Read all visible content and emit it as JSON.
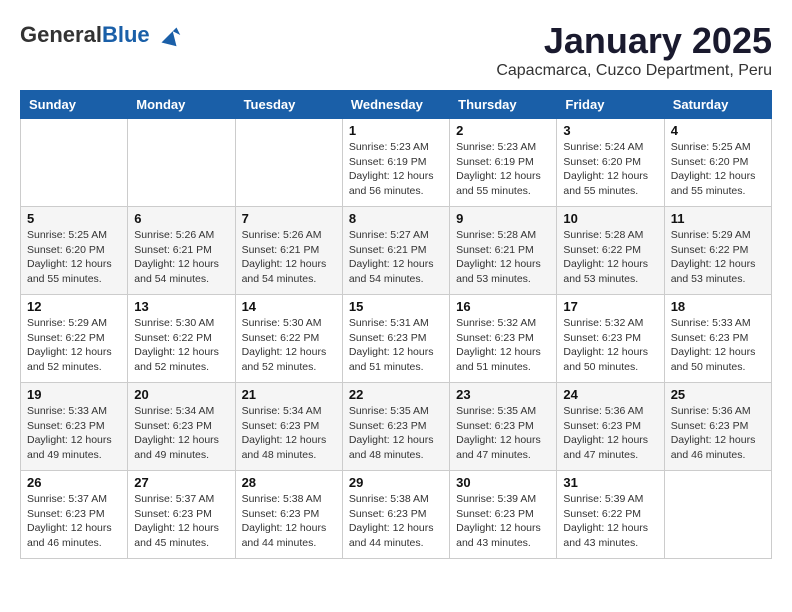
{
  "logo": {
    "general": "General",
    "blue": "Blue"
  },
  "header": {
    "month": "January 2025",
    "location": "Capacmarca, Cuzco Department, Peru"
  },
  "weekdays": [
    "Sunday",
    "Monday",
    "Tuesday",
    "Wednesday",
    "Thursday",
    "Friday",
    "Saturday"
  ],
  "weeks": [
    [
      {
        "day": "",
        "sunrise": "",
        "sunset": "",
        "daylight": ""
      },
      {
        "day": "",
        "sunrise": "",
        "sunset": "",
        "daylight": ""
      },
      {
        "day": "",
        "sunrise": "",
        "sunset": "",
        "daylight": ""
      },
      {
        "day": "1",
        "sunrise": "Sunrise: 5:23 AM",
        "sunset": "Sunset: 6:19 PM",
        "daylight": "Daylight: 12 hours and 56 minutes."
      },
      {
        "day": "2",
        "sunrise": "Sunrise: 5:23 AM",
        "sunset": "Sunset: 6:19 PM",
        "daylight": "Daylight: 12 hours and 55 minutes."
      },
      {
        "day": "3",
        "sunrise": "Sunrise: 5:24 AM",
        "sunset": "Sunset: 6:20 PM",
        "daylight": "Daylight: 12 hours and 55 minutes."
      },
      {
        "day": "4",
        "sunrise": "Sunrise: 5:25 AM",
        "sunset": "Sunset: 6:20 PM",
        "daylight": "Daylight: 12 hours and 55 minutes."
      }
    ],
    [
      {
        "day": "5",
        "sunrise": "Sunrise: 5:25 AM",
        "sunset": "Sunset: 6:20 PM",
        "daylight": "Daylight: 12 hours and 55 minutes."
      },
      {
        "day": "6",
        "sunrise": "Sunrise: 5:26 AM",
        "sunset": "Sunset: 6:21 PM",
        "daylight": "Daylight: 12 hours and 54 minutes."
      },
      {
        "day": "7",
        "sunrise": "Sunrise: 5:26 AM",
        "sunset": "Sunset: 6:21 PM",
        "daylight": "Daylight: 12 hours and 54 minutes."
      },
      {
        "day": "8",
        "sunrise": "Sunrise: 5:27 AM",
        "sunset": "Sunset: 6:21 PM",
        "daylight": "Daylight: 12 hours and 54 minutes."
      },
      {
        "day": "9",
        "sunrise": "Sunrise: 5:28 AM",
        "sunset": "Sunset: 6:21 PM",
        "daylight": "Daylight: 12 hours and 53 minutes."
      },
      {
        "day": "10",
        "sunrise": "Sunrise: 5:28 AM",
        "sunset": "Sunset: 6:22 PM",
        "daylight": "Daylight: 12 hours and 53 minutes."
      },
      {
        "day": "11",
        "sunrise": "Sunrise: 5:29 AM",
        "sunset": "Sunset: 6:22 PM",
        "daylight": "Daylight: 12 hours and 53 minutes."
      }
    ],
    [
      {
        "day": "12",
        "sunrise": "Sunrise: 5:29 AM",
        "sunset": "Sunset: 6:22 PM",
        "daylight": "Daylight: 12 hours and 52 minutes."
      },
      {
        "day": "13",
        "sunrise": "Sunrise: 5:30 AM",
        "sunset": "Sunset: 6:22 PM",
        "daylight": "Daylight: 12 hours and 52 minutes."
      },
      {
        "day": "14",
        "sunrise": "Sunrise: 5:30 AM",
        "sunset": "Sunset: 6:22 PM",
        "daylight": "Daylight: 12 hours and 52 minutes."
      },
      {
        "day": "15",
        "sunrise": "Sunrise: 5:31 AM",
        "sunset": "Sunset: 6:23 PM",
        "daylight": "Daylight: 12 hours and 51 minutes."
      },
      {
        "day": "16",
        "sunrise": "Sunrise: 5:32 AM",
        "sunset": "Sunset: 6:23 PM",
        "daylight": "Daylight: 12 hours and 51 minutes."
      },
      {
        "day": "17",
        "sunrise": "Sunrise: 5:32 AM",
        "sunset": "Sunset: 6:23 PM",
        "daylight": "Daylight: 12 hours and 50 minutes."
      },
      {
        "day": "18",
        "sunrise": "Sunrise: 5:33 AM",
        "sunset": "Sunset: 6:23 PM",
        "daylight": "Daylight: 12 hours and 50 minutes."
      }
    ],
    [
      {
        "day": "19",
        "sunrise": "Sunrise: 5:33 AM",
        "sunset": "Sunset: 6:23 PM",
        "daylight": "Daylight: 12 hours and 49 minutes."
      },
      {
        "day": "20",
        "sunrise": "Sunrise: 5:34 AM",
        "sunset": "Sunset: 6:23 PM",
        "daylight": "Daylight: 12 hours and 49 minutes."
      },
      {
        "day": "21",
        "sunrise": "Sunrise: 5:34 AM",
        "sunset": "Sunset: 6:23 PM",
        "daylight": "Daylight: 12 hours and 48 minutes."
      },
      {
        "day": "22",
        "sunrise": "Sunrise: 5:35 AM",
        "sunset": "Sunset: 6:23 PM",
        "daylight": "Daylight: 12 hours and 48 minutes."
      },
      {
        "day": "23",
        "sunrise": "Sunrise: 5:35 AM",
        "sunset": "Sunset: 6:23 PM",
        "daylight": "Daylight: 12 hours and 47 minutes."
      },
      {
        "day": "24",
        "sunrise": "Sunrise: 5:36 AM",
        "sunset": "Sunset: 6:23 PM",
        "daylight": "Daylight: 12 hours and 47 minutes."
      },
      {
        "day": "25",
        "sunrise": "Sunrise: 5:36 AM",
        "sunset": "Sunset: 6:23 PM",
        "daylight": "Daylight: 12 hours and 46 minutes."
      }
    ],
    [
      {
        "day": "26",
        "sunrise": "Sunrise: 5:37 AM",
        "sunset": "Sunset: 6:23 PM",
        "daylight": "Daylight: 12 hours and 46 minutes."
      },
      {
        "day": "27",
        "sunrise": "Sunrise: 5:37 AM",
        "sunset": "Sunset: 6:23 PM",
        "daylight": "Daylight: 12 hours and 45 minutes."
      },
      {
        "day": "28",
        "sunrise": "Sunrise: 5:38 AM",
        "sunset": "Sunset: 6:23 PM",
        "daylight": "Daylight: 12 hours and 44 minutes."
      },
      {
        "day": "29",
        "sunrise": "Sunrise: 5:38 AM",
        "sunset": "Sunset: 6:23 PM",
        "daylight": "Daylight: 12 hours and 44 minutes."
      },
      {
        "day": "30",
        "sunrise": "Sunrise: 5:39 AM",
        "sunset": "Sunset: 6:23 PM",
        "daylight": "Daylight: 12 hours and 43 minutes."
      },
      {
        "day": "31",
        "sunrise": "Sunrise: 5:39 AM",
        "sunset": "Sunset: 6:22 PM",
        "daylight": "Daylight: 12 hours and 43 minutes."
      },
      {
        "day": "",
        "sunrise": "",
        "sunset": "",
        "daylight": ""
      }
    ]
  ]
}
